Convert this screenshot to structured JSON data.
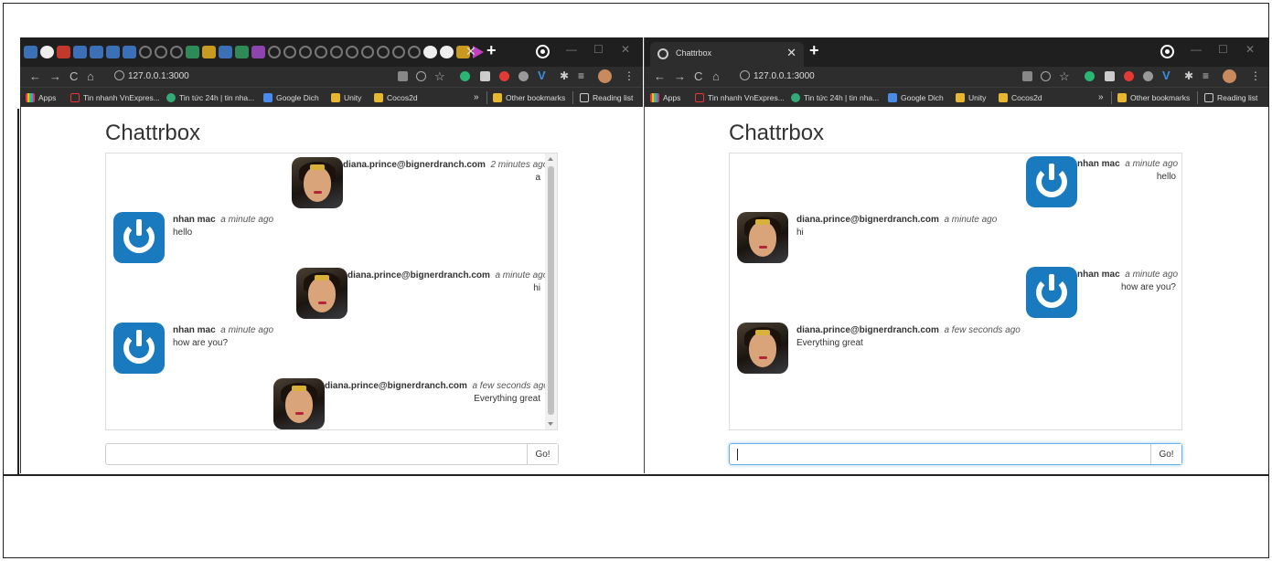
{
  "left_window": {
    "url": "127.0.0.1:3000",
    "app_title": "Chattrbox",
    "messages": [
      {
        "side": "right",
        "sender": "diana.prince@bignerdranch.com",
        "time": "2 minutes ago",
        "text": "a",
        "avatar": "wonder-woman-avatar"
      },
      {
        "side": "left",
        "sender": "nhan mac",
        "time": "a minute ago",
        "text": "hello",
        "avatar": "power-icon-avatar"
      },
      {
        "side": "right",
        "sender": "diana.prince@bignerdranch.com",
        "time": "a minute ago",
        "text": "hi",
        "avatar": "wonder-woman-avatar"
      },
      {
        "side": "left",
        "sender": "nhan mac",
        "time": "a minute ago",
        "text": "how are you?",
        "avatar": "power-icon-avatar"
      },
      {
        "side": "right",
        "sender": "diana.prince@bignerdranch.com",
        "time": "a few seconds ago",
        "text": "Everything great",
        "avatar": "wonder-woman-avatar"
      }
    ],
    "input_value": "",
    "go_label": "Go!"
  },
  "right_window": {
    "tab_title": "Chattrbox",
    "url": "127.0.0.1:3000",
    "app_title": "Chattrbox",
    "messages": [
      {
        "side": "right",
        "sender": "nhan mac",
        "time": "a minute ago",
        "text": "hello",
        "avatar": "power-icon-avatar"
      },
      {
        "side": "left",
        "sender": "diana.prince@bignerdranch.com",
        "time": "a minute ago",
        "text": "hi",
        "avatar": "wonder-woman-avatar"
      },
      {
        "side": "right",
        "sender": "nhan mac",
        "time": "a minute ago",
        "text": "how are you?",
        "avatar": "power-icon-avatar"
      },
      {
        "side": "left",
        "sender": "diana.prince@bignerdranch.com",
        "time": "a few seconds ago",
        "text": "Everything great",
        "avatar": "wonder-woman-avatar"
      }
    ],
    "input_value": "",
    "go_label": "Go!"
  },
  "bookmarks": {
    "apps": "Apps",
    "vnexpress": "Tin nhanh VnExpres...",
    "tintuc": "Tin tức 24h | tin nha...",
    "google_dich": "Google Dich",
    "unity": "Unity",
    "cocos": "Cocos2d",
    "more": "»",
    "other": "Other bookmarks",
    "reading": "Reading list"
  },
  "colors": {
    "chrome_dark": "#1f1f1f",
    "toolbar": "#2d2d2d",
    "power_avatar_blue": "#1a7ac0",
    "focus_blue": "#66afe9"
  }
}
